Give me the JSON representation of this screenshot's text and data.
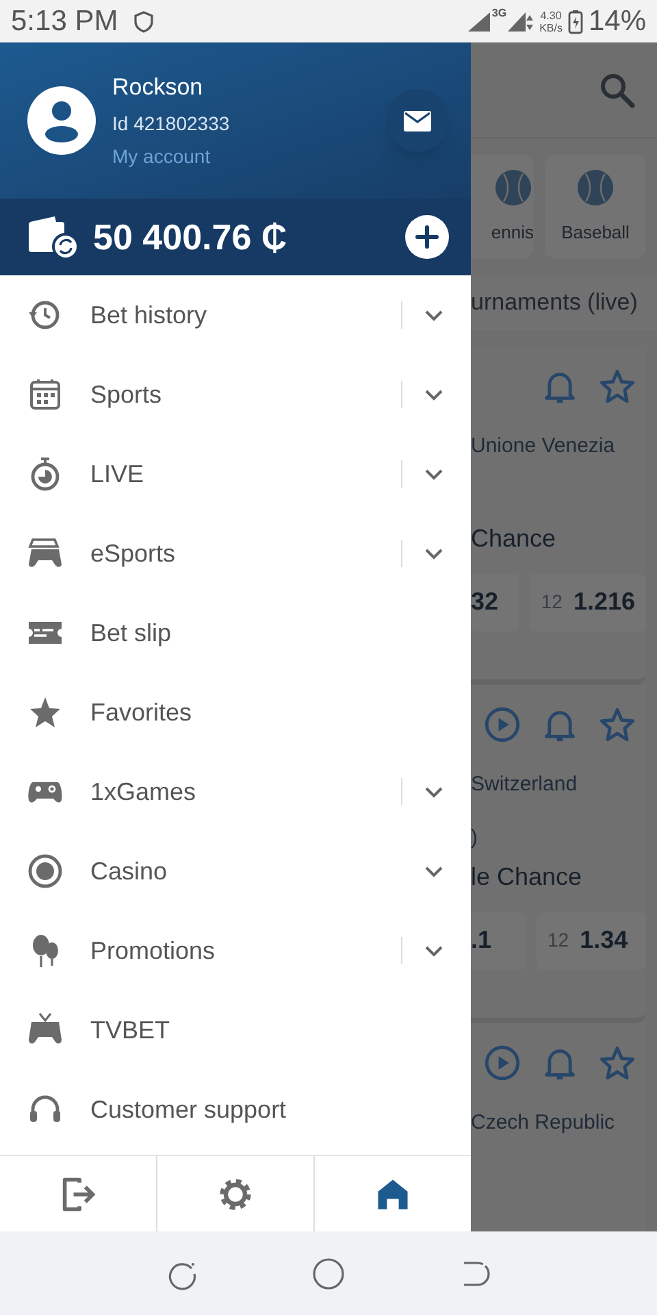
{
  "status_bar": {
    "time": "5:13 PM",
    "network": "3G",
    "speed": "4.30",
    "speed_unit": "KB/s",
    "battery": "14%"
  },
  "drawer": {
    "user": {
      "name": "Rockson",
      "id": "Id 421802333",
      "account_link": "My account"
    },
    "balance": "50 400.76 ₵",
    "menu": [
      {
        "label": "Bet history",
        "kind": "dropdown"
      },
      {
        "label": "Sports",
        "kind": "dropdown"
      },
      {
        "label": "LIVE",
        "kind": "dropdown"
      },
      {
        "label": "eSports",
        "kind": "dropdown"
      },
      {
        "label": "Bet slip",
        "kind": "link"
      },
      {
        "label": "Favorites",
        "kind": "link"
      },
      {
        "label": "1xGames",
        "kind": "dropdown"
      },
      {
        "label": "Casino",
        "kind": "dropdown_plain"
      },
      {
        "label": "Promotions",
        "kind": "dropdown"
      },
      {
        "label": "TVBET",
        "kind": "link"
      },
      {
        "label": "Customer support",
        "kind": "link"
      }
    ],
    "bottom_bar": [
      {
        "selected": false
      },
      {
        "selected": false
      },
      {
        "selected": true
      }
    ]
  },
  "background": {
    "sports": [
      "ennis",
      "Baseball"
    ],
    "section": "urnaments (live)",
    "events": [
      {
        "video": false,
        "team": "Unione Venezia",
        "market": "Chance",
        "odds": [
          {
            "value": "32"
          },
          {
            "label": "12",
            "value": "1.216"
          }
        ]
      },
      {
        "video": true,
        "team": "Switzerland",
        "extra": ")",
        "market": "le Chance",
        "odds": [
          {
            "value": ".1"
          },
          {
            "label": "12",
            "value": "1.34"
          }
        ]
      },
      {
        "video": true,
        "team": "Czech Republic"
      }
    ]
  }
}
